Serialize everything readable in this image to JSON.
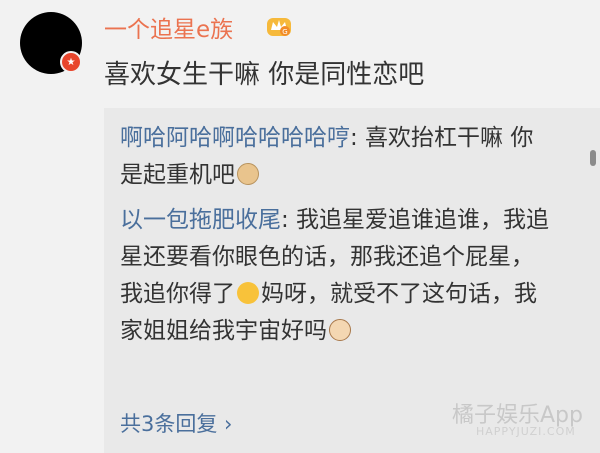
{
  "comment": {
    "username": "一个追星e族",
    "text": "喜欢女生干嘛 你是同性恋吧"
  },
  "replies": [
    {
      "author": "啊哈阿哈啊哈哈哈哈哼",
      "text": ": 喜欢抬杠干嘛 你是起重机吧"
    },
    {
      "author": "以一包拖肥收尾",
      "text": ": 我追星爱追谁追谁，我追星还要看你眼色的话，那我还追个屁星，我追你得了",
      "text2": "妈呀，就受不了这句话，我家姐姐给我宇宙好吗"
    }
  ],
  "more_replies": "共3条回复 ›",
  "watermark": {
    "main": "橘子娱乐App",
    "sub": "HAPPYJUZI.COM"
  },
  "colors": {
    "username": "#eb7350",
    "link": "#4a6f9c",
    "background": "#f2f2f2",
    "reply_bg": "#e9e9e9"
  },
  "icons": [
    "avatar",
    "vip-crown-icon",
    "doge-emoji",
    "drool-emoji",
    "cat-emoji"
  ]
}
